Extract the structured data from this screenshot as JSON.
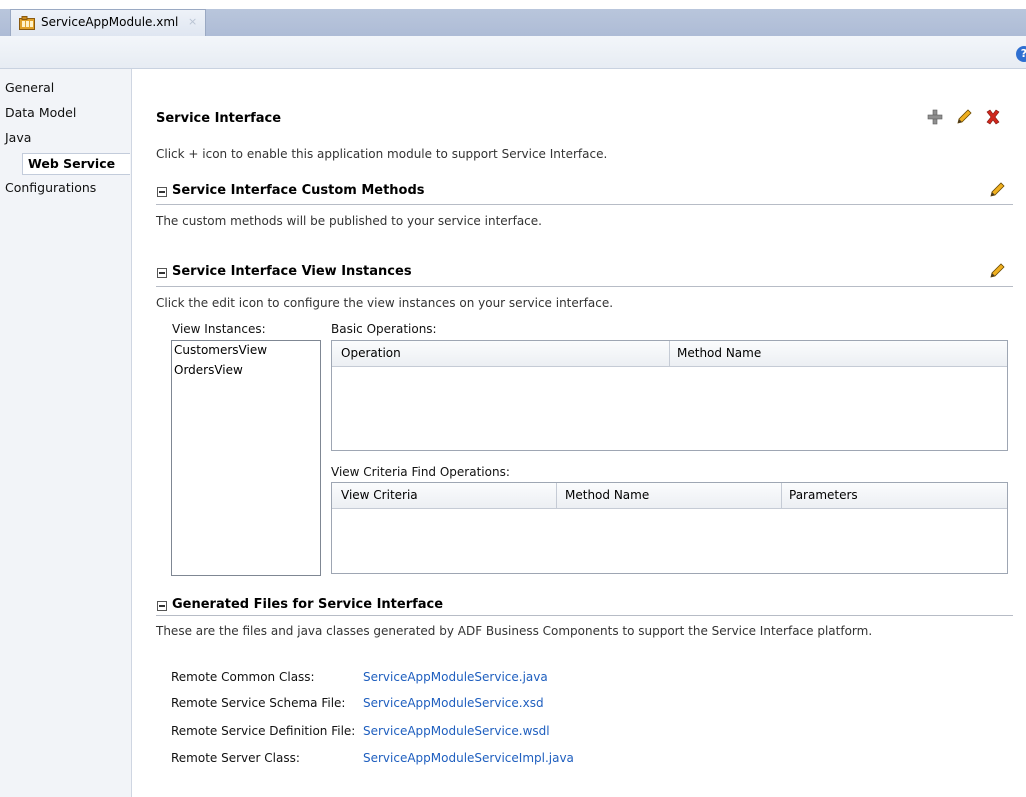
{
  "editor_tab": {
    "title": "ServiceAppModule.xml",
    "close": "×"
  },
  "help": {
    "label": "?"
  },
  "nav": {
    "items": [
      "General",
      "Data Model",
      "Java",
      "Web Service",
      "Configurations"
    ],
    "selected": "Web Service"
  },
  "service_interface": {
    "title": "Service Interface",
    "description": "Click + icon to enable this application module to support Service Interface."
  },
  "custom_methods": {
    "title": "Service Interface Custom Methods",
    "description": "The custom methods will be published to your service interface."
  },
  "view_instances": {
    "title": "Service Interface View Instances",
    "description": "Click the edit icon to configure the view instances on your service interface.",
    "list_label": "View Instances:",
    "list": [
      "CustomersView",
      "OrdersView"
    ],
    "basic_ops_label": "Basic Operations:",
    "basic_ops_columns": [
      "Operation",
      "Method Name"
    ],
    "criteria_label": "View Criteria Find Operations:",
    "criteria_columns": [
      "View Criteria",
      "Method Name",
      "Parameters"
    ]
  },
  "generated_files": {
    "title": "Generated Files for Service Interface",
    "description": "These are the files and java classes generated by ADF Business Components to support the Service Interface platform.",
    "rows": [
      {
        "label": "Remote Common Class:",
        "value": "ServiceAppModuleService.java"
      },
      {
        "label": "Remote Service Schema File:",
        "value": "ServiceAppModuleService.xsd"
      },
      {
        "label": "Remote Service Definition File:",
        "value": "ServiceAppModuleService.wsdl"
      },
      {
        "label": "Remote Server Class:",
        "value": "ServiceAppModuleServiceImpl.java"
      }
    ]
  },
  "colors": {
    "link": "#1f5fbf",
    "delete": "#d0281d",
    "pencil": "#e8a200"
  }
}
